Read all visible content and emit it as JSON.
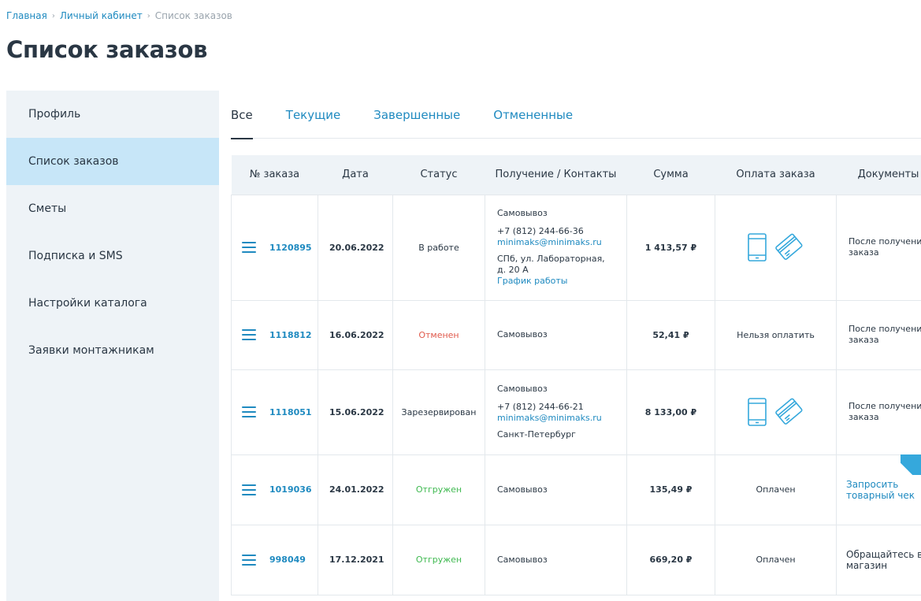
{
  "breadcrumb": {
    "home": "Главная",
    "cabinet": "Личный кабинет",
    "current": "Список заказов"
  },
  "page_title": "Список заказов",
  "sidebar": {
    "items": [
      {
        "label": "Профиль"
      },
      {
        "label": "Список заказов"
      },
      {
        "label": "Сметы"
      },
      {
        "label": "Подписка и SMS"
      },
      {
        "label": "Настройки каталога"
      },
      {
        "label": "Заявки монтажникам"
      }
    ]
  },
  "tabs": [
    {
      "label": "Все"
    },
    {
      "label": "Текущие"
    },
    {
      "label": "Завершенные"
    },
    {
      "label": "Отмененные"
    }
  ],
  "table": {
    "headers": {
      "num": "№ заказа",
      "date": "Дата",
      "status": "Статус",
      "contact": "Получение / Контакты",
      "sum": "Сумма",
      "pay": "Оплата заказа",
      "docs": "Документы"
    },
    "rows": [
      {
        "num": "1120895",
        "date": "20.06.2022",
        "status": "В работе",
        "method": "Самовывоз",
        "phone": "+7 (812) 244-66-36",
        "email": "minimaks@minimaks.ru",
        "addr": "СПб, ул. Лабораторная, д. 20 А",
        "hours": "График работы",
        "sum": "1 413,57 ₽",
        "docs": "После получения заказа"
      },
      {
        "num": "1118812",
        "date": "16.06.2022",
        "status": "Отменен",
        "method": "Самовывоз",
        "sum": "52,41 ₽",
        "pay": "Нельзя оплатить",
        "docs": "После получения заказа"
      },
      {
        "num": "1118051",
        "date": "15.06.2022",
        "status": "Зарезервирован",
        "method": "Самовывоз",
        "phone": "+7 (812) 244-66-21",
        "email": "minimaks@minimaks.ru",
        "addr": "Санкт-Петербург",
        "sum": "8 133,00 ₽",
        "docs": "После получения заказа"
      },
      {
        "num": "1019036",
        "date": "24.01.2022",
        "status": "Отгружен",
        "method": "Самовывоз",
        "sum": "135,49 ₽",
        "pay": "Оплачен",
        "docs": "Запросить товарный чек"
      },
      {
        "num": "998049",
        "date": "17.12.2021",
        "status": "Отгружен",
        "method": "Самовывоз",
        "sum": "669,20 ₽",
        "pay": "Оплачен",
        "docs": "Обращайтесь в магазин"
      }
    ]
  },
  "colors": {
    "accent": "#1f8ac0",
    "sidebar_bg": "#eef3f7",
    "sidebar_active": "#c7e6f8",
    "status_cancel": "#e05a4c",
    "status_shipped": "#3fb950",
    "pay_icon": "#35a8dc"
  },
  "icons": {
    "row_menu": "hamburger-menu-icon",
    "pay_phone": "mobile-phone-icon",
    "pay_card": "credit-card-icon"
  }
}
